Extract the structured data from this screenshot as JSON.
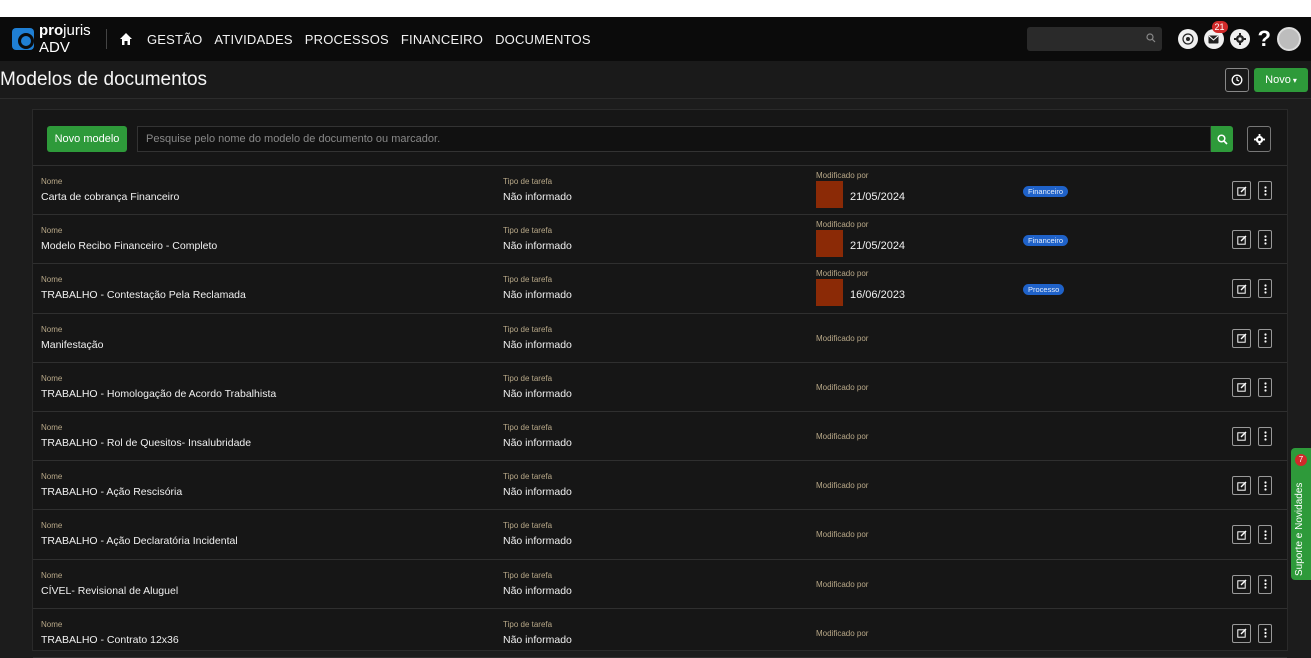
{
  "nav": {
    "logo_bold": "pro",
    "logo_rest": "juris",
    "logo_sub": "ADV",
    "menu": [
      "GESTÃO",
      "ATIVIDADES",
      "PROCESSOS",
      "FINANCEIRO",
      "DOCUMENTOS"
    ],
    "notification_count": "21",
    "help": "?"
  },
  "page": {
    "title": "Modelos de documentos",
    "new_label": "Novo"
  },
  "toolbar": {
    "new_model_label": "Novo modelo",
    "search_placeholder": "Pesquise pelo nome do modelo de documento ou marcador."
  },
  "labels": {
    "name": "Nome",
    "task_type": "Tipo de tarefa",
    "modified_by": "Modificado por"
  },
  "rows": [
    {
      "name": "Carta de cobrança Financeiro",
      "task_type": "Não informado",
      "date": "21/05/2024",
      "tag": "Financeiro"
    },
    {
      "name": "Modelo Recibo Financeiro - Completo",
      "task_type": "Não informado",
      "date": "21/05/2024",
      "tag": "Financeiro"
    },
    {
      "name": "TRABALHO - Contestação Pela Reclamada",
      "task_type": "Não informado",
      "date": "16/06/2023",
      "tag": "Processo"
    },
    {
      "name": "Manifestação",
      "task_type": "Não informado",
      "date": "",
      "tag": ""
    },
    {
      "name": "TRABALHO - Homologação de Acordo Trabalhista",
      "task_type": "Não informado",
      "date": "",
      "tag": ""
    },
    {
      "name": "TRABALHO - Rol de Quesitos- Insalubridade",
      "task_type": "Não informado",
      "date": "",
      "tag": ""
    },
    {
      "name": "TRABALHO - Ação Rescisória",
      "task_type": "Não informado",
      "date": "",
      "tag": ""
    },
    {
      "name": "TRABALHO - Ação Declaratória Incidental",
      "task_type": "Não informado",
      "date": "",
      "tag": ""
    },
    {
      "name": "CÍVEL- Revisional de Aluguel",
      "task_type": "Não informado",
      "date": "",
      "tag": ""
    },
    {
      "name": "TRABALHO - Contrato 12x36",
      "task_type": "Não informado",
      "date": "",
      "tag": ""
    }
  ],
  "side_tab": {
    "label": "Suporte e Novidades",
    "count": "7"
  },
  "colors": {
    "accent_green": "#2e9a3a",
    "tag_blue": "#1f62c9",
    "thumb_rust": "#8b2a06"
  }
}
